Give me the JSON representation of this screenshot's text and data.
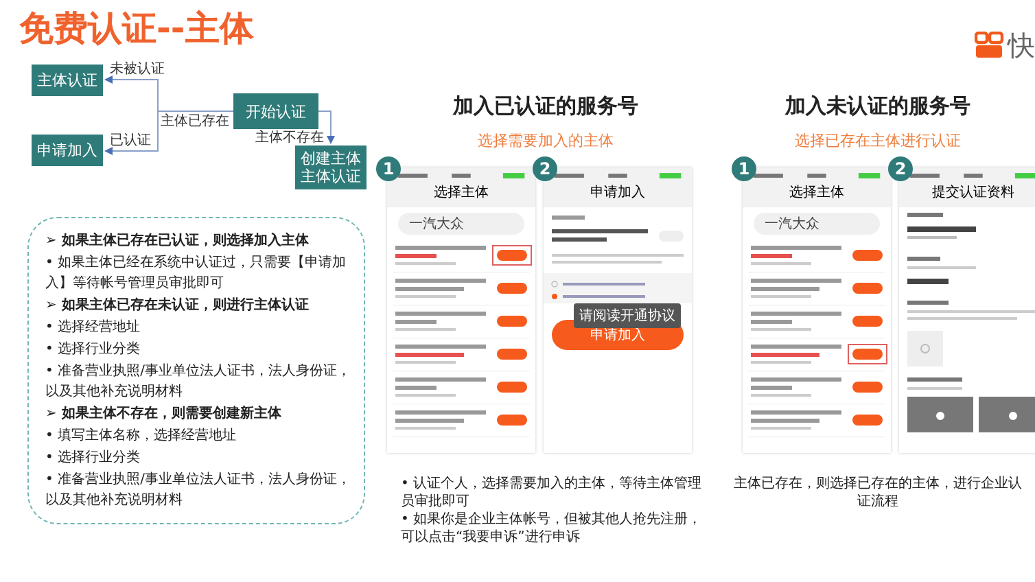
{
  "title": "免费认证--主体",
  "logo": {
    "text": "快"
  },
  "flowchart": {
    "nodes": [
      {
        "label": "主体认证"
      },
      {
        "label": "申请加入"
      },
      {
        "label": "开始认证"
      },
      {
        "label": "创建主体主体认证"
      }
    ],
    "edge_labels": [
      "未被认证",
      "主体已存在",
      "已认证",
      "主体不存在"
    ]
  },
  "notes": [
    {
      "kind": "heading",
      "text": "➢ 如果主体已存在已认证，则选择加入主体"
    },
    {
      "kind": "bullet",
      "text": "• 如果主体已经在系统中认证过，只需要【申请加入】等待帐号管理员审批即可"
    },
    {
      "kind": "heading",
      "text": "➢ 如果主体已存在未认证，则进行主体认证"
    },
    {
      "kind": "bullet",
      "text": "• 选择经营地址"
    },
    {
      "kind": "bullet",
      "text": "• 选择行业分类"
    },
    {
      "kind": "bullet",
      "text": "• 准备营业执照/事业单位法人证书，法人身份证，以及其他补充说明材料"
    },
    {
      "kind": "heading",
      "text": "➢ 如果主体不存在，则需要创建新主体"
    },
    {
      "kind": "bullet",
      "text": "• 填写主体名称，选择经营地址"
    },
    {
      "kind": "bullet",
      "text": "• 选择行业分类"
    },
    {
      "kind": "bullet",
      "text": "• 准备营业执照/事业单位法人证书，法人身份证，以及其他补充说明材料"
    }
  ],
  "panels": [
    {
      "heading": "加入已认证的服务号",
      "subtitle": "选择需要加入的主体",
      "phones": [
        {
          "number": "1",
          "kind": "list",
          "title": "选择主体",
          "search": "一汽大众"
        },
        {
          "number": "2",
          "kind": "apply",
          "title": "申请加入",
          "button": "申请加入",
          "toast": "请阅读开通协议"
        }
      ],
      "notes": [
        "• 认证个人，选择需要加入的主体，等待主体管理员审批即可",
        "• 如果你是企业主体帐号，但被其他人抢先注册，可以点击“我要申诉”进行申诉"
      ]
    },
    {
      "heading": "加入未认证的服务号",
      "subtitle": "选择已存在主体进行认证",
      "phones": [
        {
          "number": "1",
          "kind": "list",
          "title": "选择主体",
          "search": "一汽大众"
        },
        {
          "number": "2",
          "kind": "form",
          "title": "提交认证资料"
        }
      ],
      "notes": [
        "主体已存在，则选择已存在的主体，进行企业认证流程"
      ]
    }
  ]
}
